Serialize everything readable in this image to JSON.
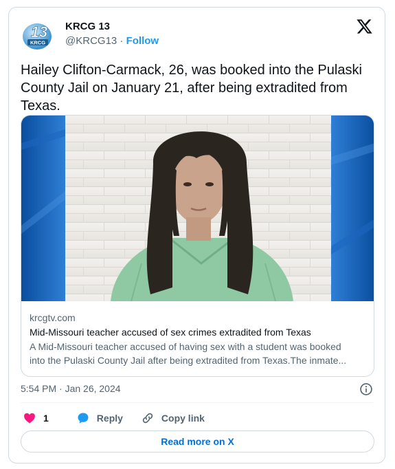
{
  "account": {
    "name": "KRCG 13",
    "handle": "@KRCG13",
    "separator": "·",
    "follow_label": "Follow",
    "avatar_logo": {
      "number": "13",
      "letters": "KRCG"
    }
  },
  "tweet": {
    "text": "Hailey Clifton-Carmack, 26, was booked into the Pulaski County Jail on January 21, after being extradited from Texas."
  },
  "link_card": {
    "domain": "krcgtv.com",
    "title": "Mid-Missouri teacher accused of sex crimes extradited from Texas",
    "description_line1": "A Mid-Missouri teacher accused of having sex with a student was booked",
    "description_line2": "into the Pulaski County Jail after being extradited from Texas.The inmate..."
  },
  "timestamp": "5:54 PM · Jan 26, 2024",
  "actions": {
    "like_count": "1",
    "reply_label": "Reply",
    "copy_link_label": "Copy link"
  },
  "read_more_label": "Read more on X",
  "icons": {
    "logo": "x-logo-icon",
    "info": "info-icon",
    "like": "heart-icon",
    "reply": "speech-bubble-icon",
    "copy": "link-icon"
  },
  "colors": {
    "accent": "#1d9bf0",
    "like": "#f91880",
    "read_more": "#006fd6",
    "secondary_text": "#536471",
    "border": "#cfd9de"
  }
}
